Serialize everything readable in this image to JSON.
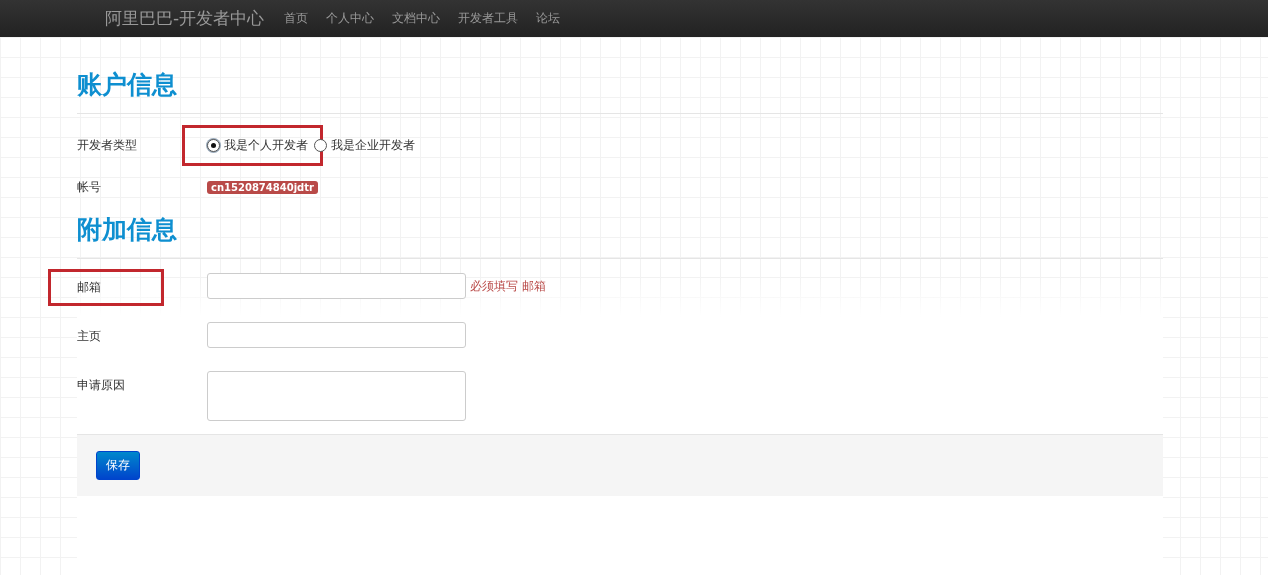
{
  "navbar": {
    "brand": "阿里巴巴-开发者中心",
    "links": [
      "首页",
      "个人中心",
      "文档中心",
      "开发者工具",
      "论坛"
    ]
  },
  "account_section": {
    "title": "账户信息",
    "developer_type": {
      "label": "开发者类型",
      "options": [
        {
          "label": "我是个人开发者",
          "selected": true,
          "highlighted": true
        },
        {
          "label": "我是企业开发者",
          "selected": false,
          "highlighted": false
        }
      ]
    },
    "account": {
      "label": "帐号",
      "value": "cn1520874840jdtr"
    }
  },
  "extra_section": {
    "title": "附加信息",
    "fields": [
      {
        "kind": "input",
        "label": "邮箱",
        "highlighted": true,
        "error": "必须填写 邮箱"
      },
      {
        "kind": "input",
        "label": "主页",
        "highlighted": false
      },
      {
        "kind": "textarea",
        "label": "申请原因",
        "highlighted": false
      }
    ]
  },
  "actions": {
    "save": "保存"
  }
}
